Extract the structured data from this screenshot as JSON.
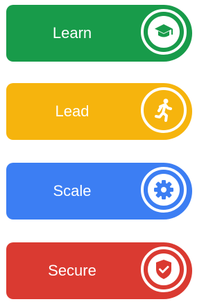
{
  "items": [
    {
      "label": "Learn",
      "icon": "graduation-cap-icon",
      "color": "#189b4a"
    },
    {
      "label": "Lead",
      "icon": "running-person-icon",
      "color": "#f6b40d"
    },
    {
      "label": "Scale",
      "icon": "gear-icon",
      "color": "#3c7ef3"
    },
    {
      "label": "Secure",
      "icon": "shield-check-icon",
      "color": "#da3a31"
    }
  ]
}
